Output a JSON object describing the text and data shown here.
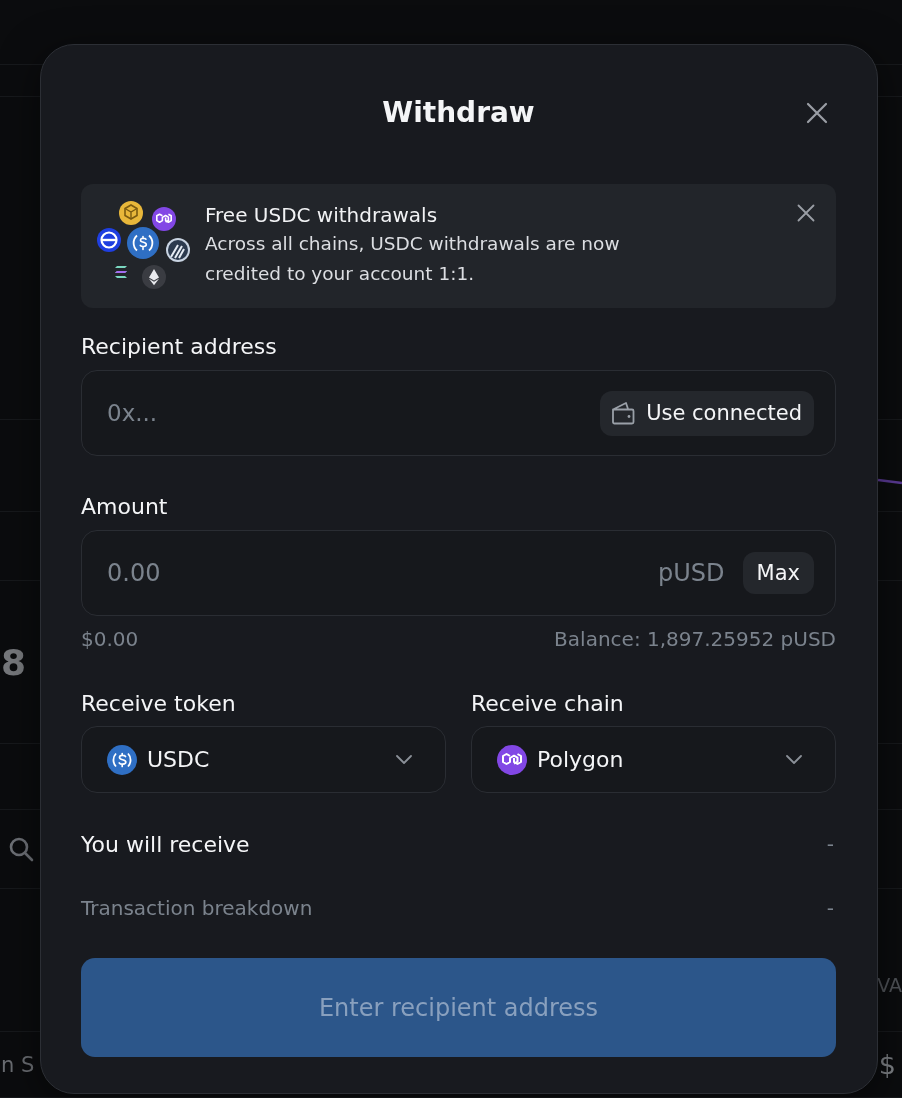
{
  "background": {
    "left_number": "8",
    "left_text": "n S",
    "right_text": "VA",
    "right_number": "$"
  },
  "dialog": {
    "title": "Withdraw",
    "banner": {
      "title": "Free USDC withdrawals",
      "text": "Across all chains, USDC withdrawals are now credited to your account 1:1."
    },
    "recipient": {
      "label": "Recipient address",
      "placeholder": "0x...",
      "button": "Use connected"
    },
    "amount": {
      "label": "Amount",
      "placeholder": "0.00",
      "unit": "pUSD",
      "button": "Max",
      "usd_value": "$0.00",
      "balance": "Balance: 1,897.25952 pUSD"
    },
    "selects": [
      {
        "label": "Receive token",
        "value": "USDC",
        "kind": "token"
      },
      {
        "label": "Receive chain",
        "value": "Polygon",
        "kind": "chain"
      }
    ],
    "summary": [
      {
        "label": "You will receive",
        "value": "-",
        "kind": "primary"
      },
      {
        "label": "Transaction breakdown",
        "value": "-",
        "kind": "secondary"
      }
    ],
    "submit": {
      "label": "Enter recipient address",
      "disabled": true
    }
  }
}
